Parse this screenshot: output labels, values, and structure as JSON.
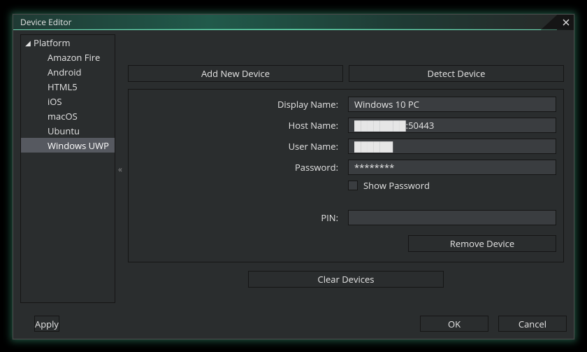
{
  "window": {
    "title": "Device Editor"
  },
  "tree": {
    "root": "Platform",
    "items": [
      {
        "label": "Amazon Fire"
      },
      {
        "label": "Android"
      },
      {
        "label": "HTML5"
      },
      {
        "label": "iOS"
      },
      {
        "label": "macOS"
      },
      {
        "label": "Ubuntu"
      },
      {
        "label": "Windows UWP",
        "selected": true
      }
    ]
  },
  "buttons": {
    "add_device": "Add New Device",
    "detect_device": "Detect Device",
    "remove_device": "Remove Device",
    "clear_devices": "Clear Devices",
    "apply": "Apply",
    "ok": "OK",
    "cancel": "Cancel"
  },
  "form": {
    "display_name": {
      "label": "Display Name:",
      "value": "Windows 10 PC"
    },
    "host_name": {
      "label": "Host Name:",
      "value": "████████:50443"
    },
    "user_name": {
      "label": "User Name:",
      "value": "██████"
    },
    "password": {
      "label": "Password:",
      "value": "********"
    },
    "show_password": {
      "label": "Show Password",
      "checked": false
    },
    "pin": {
      "label": "PIN:",
      "value": ""
    }
  },
  "collapse_glyph": "«"
}
